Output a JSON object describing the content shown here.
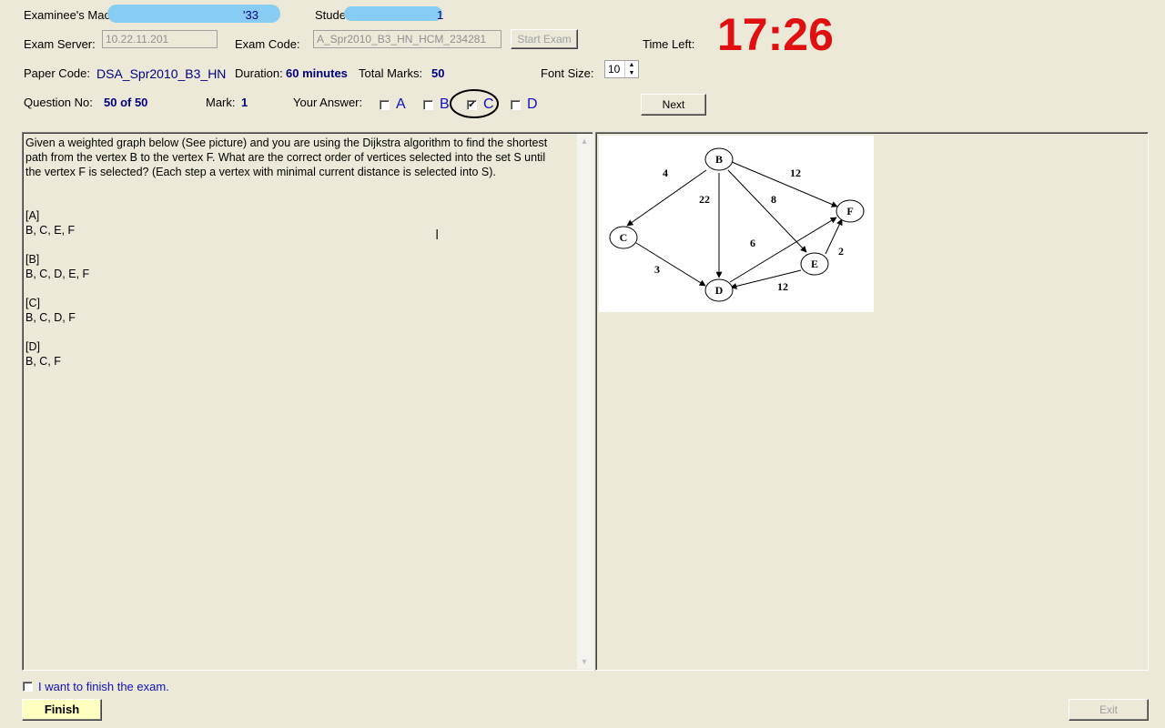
{
  "header": {
    "examinee_machine_label": "Examinee's Machi",
    "examinee_machine_tail": "'33",
    "student_label": "Studen",
    "student_tail": "1",
    "exam_server_label": "Exam Server:",
    "exam_server_value": "10.22.11.201",
    "exam_code_label": "Exam Code:",
    "exam_code_value": "A_Spr2010_B3_HN_HCM_234281",
    "start_exam_label": "Start Exam",
    "time_left_label": "Time Left:",
    "time_left_value": "17:26",
    "paper_code_label": "Paper Code:",
    "paper_code_value": "DSA_Spr2010_B3_HN",
    "duration_label": "Duration:",
    "duration_value": "60 minutes",
    "total_marks_label": "Total Marks:",
    "total_marks_value": "50",
    "font_size_label": "Font Size:",
    "font_size_value": "10",
    "question_no_label": "Question No:",
    "question_no_value": "50 of 50",
    "mark_label": "Mark:",
    "mark_value": "1",
    "your_answer_label": "Your Answer:",
    "options": [
      {
        "letter": "A",
        "checked": false
      },
      {
        "letter": "B",
        "checked": false
      },
      {
        "letter": "C",
        "checked": true
      },
      {
        "letter": "D",
        "checked": false
      }
    ],
    "next_label": "Next"
  },
  "question": {
    "text_line1": "Given a weighted graph below (See picture) and you are using the Dijkstra algorithm to find the shortest",
    "text_line2": "path from the vertex  B  to the vertex  F. What are the correct order of vertices selected into the set  S until",
    "text_line3": "the vertex  F  is selected? (Each step a vertex with minimal current distance is selected into S).",
    "answers": [
      {
        "tag": "[A]",
        "text": "B, C, E, F"
      },
      {
        "tag": "[B]",
        "text": "B, C, D, E, F"
      },
      {
        "tag": "[C]",
        "text": "B, C, D, F"
      },
      {
        "tag": "[D]",
        "text": "B, C, F"
      }
    ]
  },
  "graph": {
    "nodes": [
      "B",
      "C",
      "D",
      "E",
      "F"
    ],
    "edges": [
      {
        "from": "B",
        "to": "C",
        "weight": "4"
      },
      {
        "from": "B",
        "to": "D",
        "weight": "22"
      },
      {
        "from": "B",
        "to": "E",
        "weight": "8"
      },
      {
        "from": "B",
        "to": "F",
        "weight": "12"
      },
      {
        "from": "C",
        "to": "D",
        "weight": "3"
      },
      {
        "from": "D",
        "to": "F",
        "weight": "6"
      },
      {
        "from": "E",
        "to": "D",
        "weight": "12"
      },
      {
        "from": "E",
        "to": "F",
        "weight": "2"
      }
    ]
  },
  "footer": {
    "finish_checkbox_label": "I want to finish the exam.",
    "finish_label": "Finish",
    "exit_label": "Exit"
  },
  "colors": {
    "timer": "#e01010",
    "value_text": "#000080",
    "option_letter": "#1010c0",
    "finish_button": "#ffffc0",
    "window_bg": "#ece9d8"
  }
}
